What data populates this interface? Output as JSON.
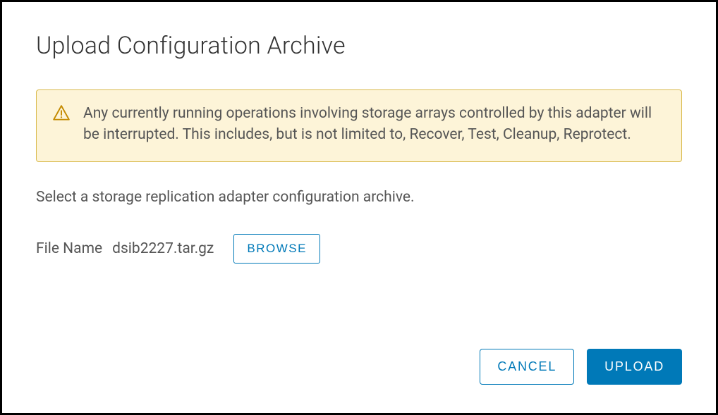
{
  "dialog": {
    "title": "Upload Configuration Archive",
    "alert": {
      "message": "Any currently running operations involving storage arrays controlled by this adapter will be interrupted. This includes, but is not limited to, Recover, Test, Cleanup, Reprotect."
    },
    "instruction": "Select a storage replication adapter configuration archive.",
    "file": {
      "label": "File Name",
      "name": "dsib2227.tar.gz",
      "browse_label": "BROWSE"
    },
    "buttons": {
      "cancel": "CANCEL",
      "upload": "UPLOAD"
    }
  }
}
